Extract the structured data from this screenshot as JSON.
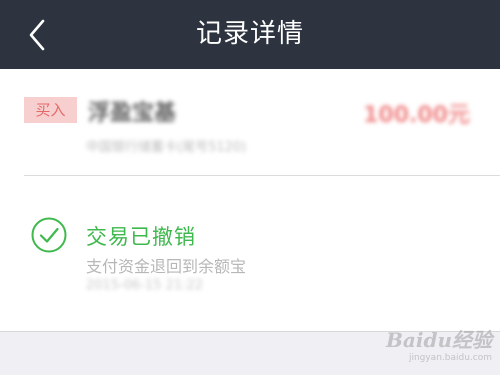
{
  "header": {
    "title": "记录详情",
    "back_icon": "chevron-left-icon"
  },
  "transaction": {
    "type_badge": "买入",
    "fund_name": "浮盈宝基",
    "amount": "100.00元",
    "sub_info": "中国银行储蓄卡(尾号5120)"
  },
  "status": {
    "icon": "check-circle-icon",
    "title": "交易已撤销",
    "description": "支付资金退回到余额宝",
    "time": "2015-06-15 21:22"
  },
  "watermark": {
    "logo": "Baidu经验",
    "url": "jingyan.baidu.com"
  },
  "colors": {
    "header_bg": "#2d3440",
    "success_green": "#3fb84d",
    "badge_bg": "#f7cfcf",
    "badge_text": "#e46a6a",
    "amount_red": "#f08a8a"
  }
}
